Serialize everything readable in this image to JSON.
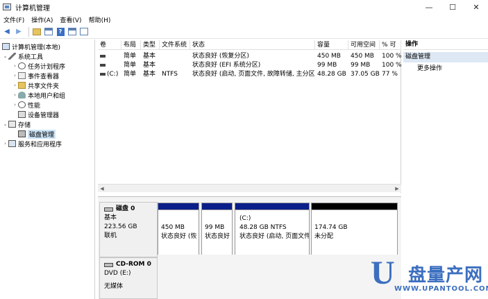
{
  "window": {
    "title": "计算机管理",
    "minimize": "—",
    "maximize": "☐",
    "close": "✕"
  },
  "menu": [
    "文件(F)",
    "操作(A)",
    "查看(V)",
    "帮助(H)"
  ],
  "toolbar": {
    "back": "◀",
    "forward": "▶",
    "help": "?"
  },
  "tree": {
    "root": "计算机管理(本地)",
    "system_tools": "系统工具",
    "task_scheduler": "任务计划程序",
    "event_viewer": "事件查看器",
    "shared_folders": "共享文件夹",
    "local_users": "本地用户和组",
    "performance": "性能",
    "device_manager": "设备管理器",
    "storage": "存储",
    "disk_management": "磁盘管理",
    "services": "服务和应用程序"
  },
  "volume_table": {
    "headers": [
      "卷",
      "布局",
      "类型",
      "文件系统",
      "状态",
      "容量",
      "可用空间",
      "% 可"
    ],
    "rows": [
      {
        "volume": "",
        "layout": "简单",
        "type": "基本",
        "fs": "",
        "status": "状态良好 (恢复分区)",
        "capacity": "450 MB",
        "free": "450 MB",
        "pct": "100 %"
      },
      {
        "volume": "",
        "layout": "简单",
        "type": "基本",
        "fs": "",
        "status": "状态良好 (EFI 系统分区)",
        "capacity": "99 MB",
        "free": "99 MB",
        "pct": "100 %"
      },
      {
        "volume": "(C:)",
        "layout": "简单",
        "type": "基本",
        "fs": "NTFS",
        "status": "状态良好 (启动, 页面文件, 故障转储, 主分区)",
        "capacity": "48.28 GB",
        "free": "37.05 GB",
        "pct": "77 %"
      }
    ]
  },
  "disk0": {
    "name": "磁盘 0",
    "type": "基本",
    "size": "223.56 GB",
    "status": "联机",
    "partitions": [
      {
        "label": "",
        "size": "450 MB",
        "status": "状态良好 (恢",
        "color": "#0b1f8a"
      },
      {
        "label": "",
        "size": "99 MB",
        "status": "状态良好",
        "color": "#0b1f8a"
      },
      {
        "label": "(C:)",
        "size": "48.28 GB NTFS",
        "status": "状态良好 (启动, 页面文件",
        "color": "#0b1f8a"
      },
      {
        "label": "",
        "size": "174.74 GB",
        "status": "未分配",
        "color": "#000000"
      }
    ]
  },
  "cdrom": {
    "name": "CD-ROM 0",
    "type": "DVD (E:)",
    "status": "无媒体"
  },
  "actions": {
    "header": "操作",
    "section": "磁盘管理",
    "more": "更多操作"
  },
  "watermark": {
    "letter": "U",
    "text": "盘量产网",
    "site": "WWW.UPANTOOL.COM"
  }
}
